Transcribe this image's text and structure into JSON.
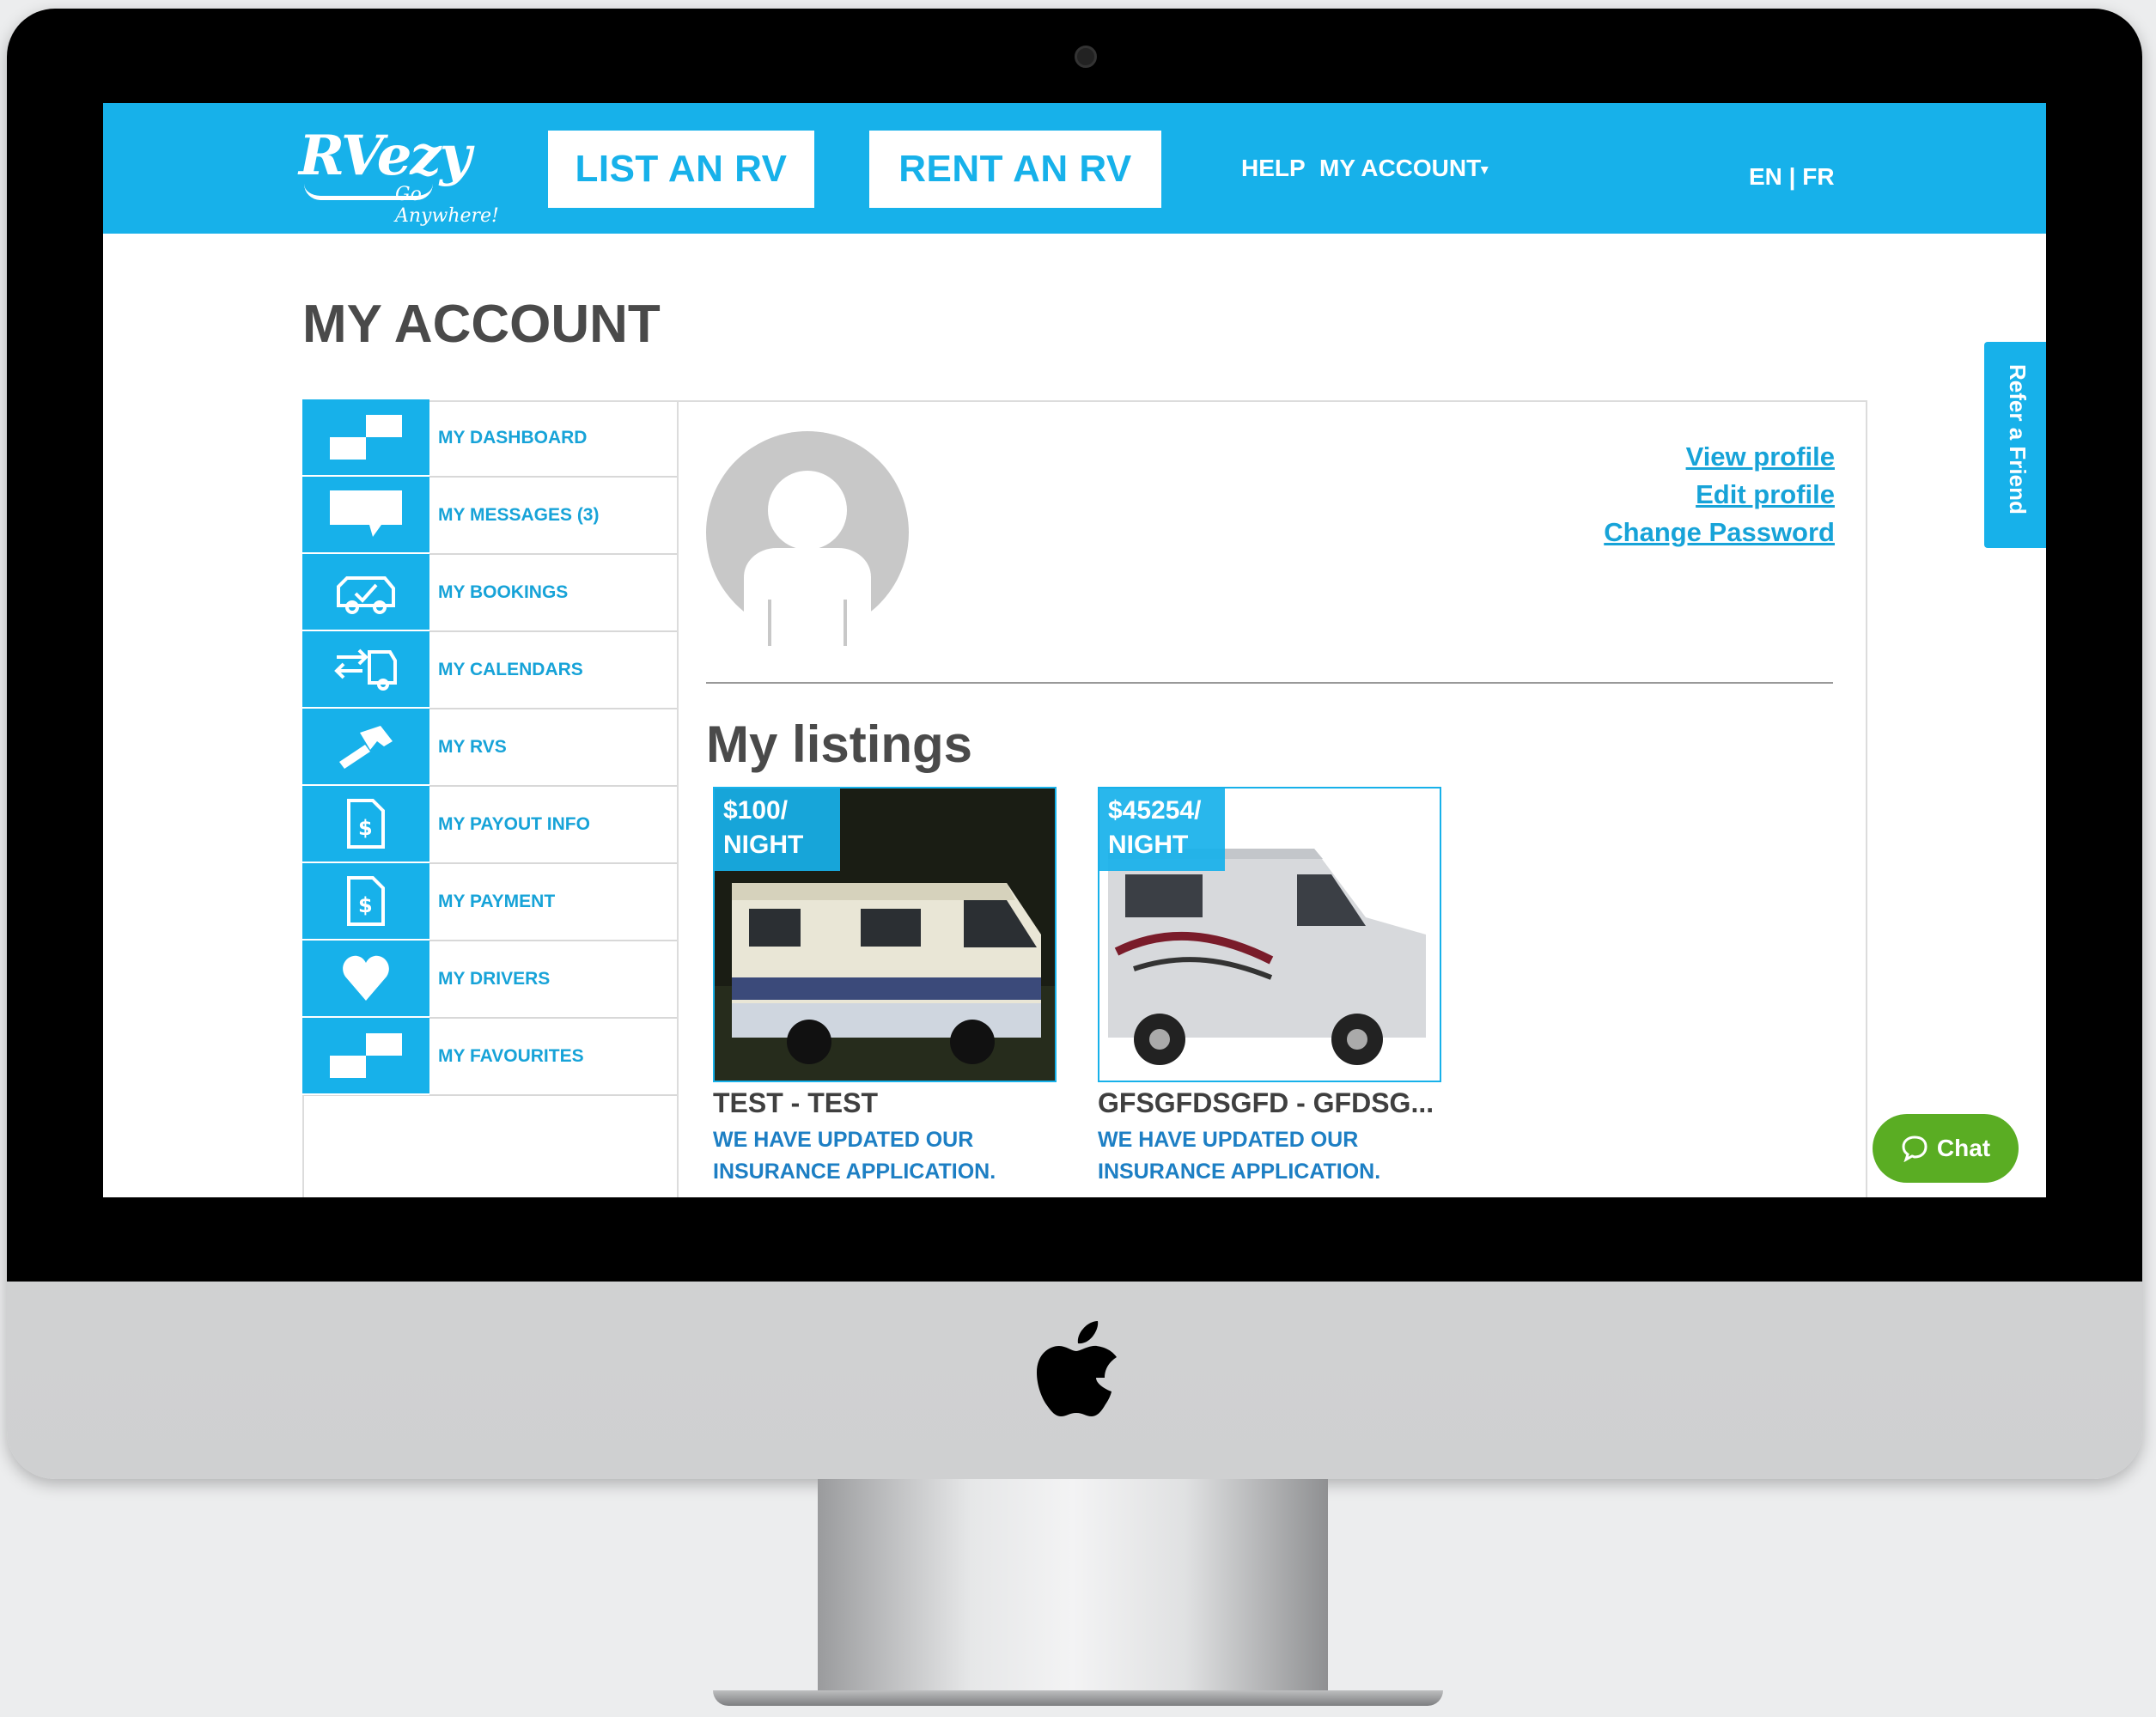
{
  "header": {
    "logo_text": "RVezy",
    "logo_tagline": "Go Anywhere!",
    "list_rv": "LIST AN RV",
    "rent_rv": "RENT AN RV",
    "help": "HELP",
    "my_account": "MY ACCOUNT",
    "lang": "EN | FR"
  },
  "page_title": "MY ACCOUNT",
  "sidebar": {
    "items": [
      {
        "label": "MY DASHBOARD",
        "icon": "dashboard-icon"
      },
      {
        "label": "MY MESSAGES (3)",
        "icon": "message-icon"
      },
      {
        "label": "MY BOOKINGS",
        "icon": "rv-booking-icon"
      },
      {
        "label": "MY CALENDARS",
        "icon": "calendar-rv-icon"
      },
      {
        "label": "MY RVS",
        "icon": "hammer-icon"
      },
      {
        "label": "MY PAYOUT INFO",
        "icon": "payout-document-icon"
      },
      {
        "label": "MY PAYMENT",
        "icon": "payment-document-icon"
      },
      {
        "label": "MY DRIVERS",
        "icon": "heart-icon"
      },
      {
        "label": "MY FAVOURITES",
        "icon": "favourites-icon"
      }
    ]
  },
  "profile": {
    "view": "View profile",
    "edit": "Edit profile",
    "change_password": "Change Password"
  },
  "listings": {
    "title": "My listings",
    "items": [
      {
        "price": "$100/ NIGHT",
        "price_line1": "$100/",
        "price_line2": "NIGHT",
        "title": "TEST - TEST",
        "subtitle": "WE HAVE UPDATED OUR INSURANCE APPLICATION."
      },
      {
        "price": "$45254/ NIGHT",
        "price_line1": "$45254/",
        "price_line2": "NIGHT",
        "title": "GFSGFDSGFD - GFDSG...",
        "subtitle": "WE HAVE UPDATED OUR INSURANCE APPLICATION."
      }
    ]
  },
  "refer_tab": "Refer a Friend",
  "chat": "Chat",
  "colors": {
    "brand": "#17b1ea",
    "chat": "#5aad23",
    "link": "#17a3d8"
  }
}
